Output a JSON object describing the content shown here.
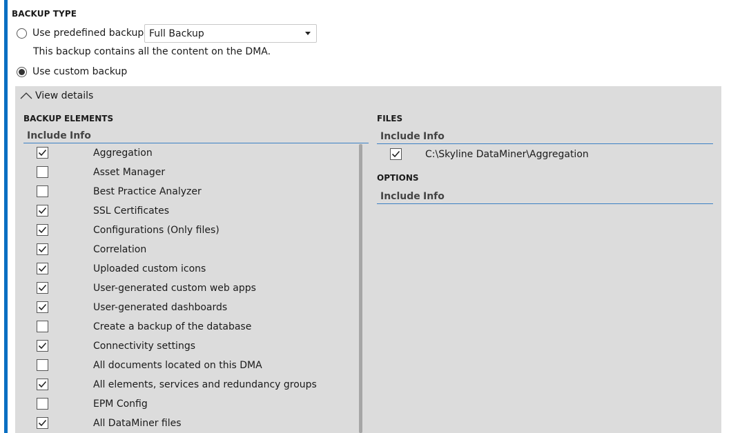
{
  "section_title": "BACKUP TYPE",
  "predefined": {
    "label": "Use predefined backup:",
    "selected": false,
    "dropdown_value": "Full Backup",
    "description": "This backup contains all the content on the DMA."
  },
  "custom": {
    "label": "Use custom backup",
    "selected": true
  },
  "details_toggle": {
    "label": "View details",
    "icon": "chevron-up-icon"
  },
  "backup_elements": {
    "title": "BACKUP ELEMENTS",
    "col_include": "Include",
    "col_info": "Info",
    "items": [
      {
        "label": "Aggregation",
        "checked": true
      },
      {
        "label": "Asset Manager",
        "checked": false
      },
      {
        "label": "Best Practice Analyzer",
        "checked": false
      },
      {
        "label": "SSL Certificates",
        "checked": true
      },
      {
        "label": "Configurations (Only files)",
        "checked": true
      },
      {
        "label": "Correlation",
        "checked": true
      },
      {
        "label": "Uploaded custom icons",
        "checked": true
      },
      {
        "label": "User-generated custom web apps",
        "checked": true
      },
      {
        "label": "User-generated dashboards",
        "checked": true
      },
      {
        "label": "Create a backup of the database",
        "checked": false
      },
      {
        "label": "Connectivity settings",
        "checked": true
      },
      {
        "label": "All documents located on this DMA",
        "checked": false
      },
      {
        "label": "All elements, services and redundancy groups",
        "checked": true
      },
      {
        "label": "EPM Config",
        "checked": false
      },
      {
        "label": "All DataMiner files",
        "checked": true
      }
    ]
  },
  "files": {
    "title": "FILES",
    "col_include": "Include",
    "col_info": "Info",
    "items": [
      {
        "label": "C:\\Skyline DataMiner\\Aggregation",
        "checked": true
      }
    ]
  },
  "options": {
    "title": "OPTIONS",
    "col_include": "Include",
    "col_info": "Info"
  },
  "colors": {
    "accent": "#0a6fc2",
    "panel": "#dcdcdc",
    "header_line": "#3a80c4"
  }
}
